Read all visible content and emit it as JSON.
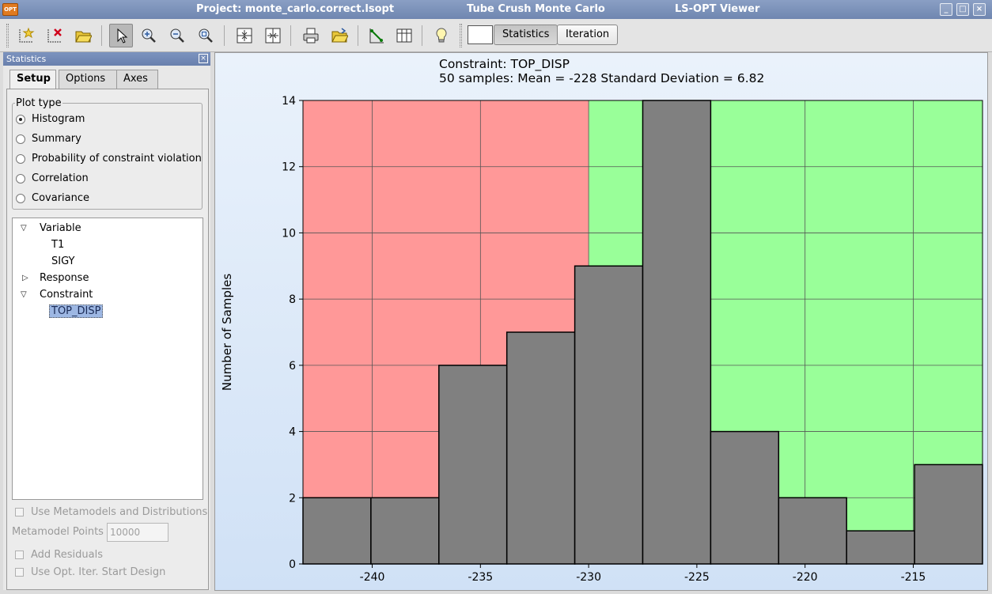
{
  "window": {
    "app_badge": "OPT",
    "project_title": "Project: monte_carlo.correct.lsopt",
    "case_title": "Tube Crush Monte Carlo",
    "viewer_title": "LS-OPT Viewer",
    "controls": [
      "minimize",
      "maximize",
      "close"
    ]
  },
  "toolbar": {
    "icons": [
      "new-plot-icon",
      "delete-plot-icon",
      "open-folder-icon",
      "select-pointer-icon",
      "zoom-in-icon",
      "zoom-out-icon",
      "zoom-fit-icon",
      "split-horizontal-icon",
      "split-vertical-icon",
      "print-icon",
      "export-folder-icon",
      "graph-settings-icon",
      "table-layout-icon",
      "lightbulb-icon"
    ],
    "active_tool": "select-pointer-icon",
    "view_buttons": [
      "Statistics",
      "Iteration"
    ],
    "selected_view": "Statistics"
  },
  "panel": {
    "title": "Statistics",
    "tabs": [
      "Setup",
      "Options",
      "Axes"
    ],
    "selected_tab": "Setup",
    "plot_type_label": "Plot type",
    "plot_types": [
      "Histogram",
      "Summary",
      "Probability of constraint violation",
      "Correlation",
      "Covariance"
    ],
    "selected_plot_type": "Histogram",
    "tree": [
      {
        "label": "Variable",
        "expanded": true
      },
      {
        "label": "T1"
      },
      {
        "label": "SIGY"
      },
      {
        "label": "Response",
        "expanded": false
      },
      {
        "label": "Constraint",
        "expanded": true
      },
      {
        "label": "TOP_DISP",
        "selected": true
      }
    ],
    "use_metamodels_label": "Use Metamodels and Distributions",
    "metamodel_points_label": "Metamodel Points",
    "metamodel_points_value": "10000",
    "add_residuals_label": "Add Residuals",
    "use_opt_iter_label": "Use Opt. Iter. Start Design"
  },
  "plot": {
    "title_line1": "Constraint: TOP_DISP",
    "title_line2": "50 samples: Mean = -228   Standard Deviation = 6.82"
  },
  "chart_data": {
    "type": "bar",
    "title": "Constraint: TOP_DISP",
    "subtitle": "50 samples: Mean = -228   Standard Deviation = 6.82",
    "xlabel": "",
    "ylabel": "Number of Samples",
    "xlim": [
      -243.2,
      -211.8
    ],
    "ylim": [
      0,
      14
    ],
    "x_ticks": [
      -240,
      -235,
      -230,
      -225,
      -220,
      -215
    ],
    "y_ticks": [
      0,
      2,
      4,
      6,
      8,
      10,
      12,
      14
    ],
    "bin_edges": [
      -243.2,
      -240.06,
      -236.92,
      -233.78,
      -230.64,
      -227.5,
      -224.36,
      -221.22,
      -218.08,
      -214.94,
      -211.8
    ],
    "counts": [
      2,
      2,
      6,
      7,
      9,
      14,
      4,
      2,
      1,
      3
    ],
    "violation_region_end": -230.0,
    "violation_color": "#ff9898",
    "feasible_color": "#99ff99",
    "bar_color": "#808080",
    "grid": true
  }
}
